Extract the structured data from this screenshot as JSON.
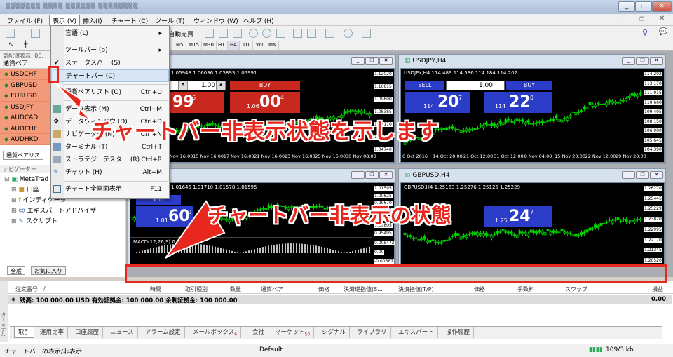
{
  "menubar": {
    "items": [
      "ファイル (F)",
      "表示 (V)",
      "挿入(I)",
      "チャート (C)",
      "ツール (T)",
      "ウィンドウ (W)",
      "ヘルプ (H)"
    ]
  },
  "toolbar": {
    "autotrade": "自動売買",
    "timeframes": [
      "M5",
      "M15",
      "M30",
      "H1",
      "H4",
      "D1",
      "W1",
      "MN"
    ]
  },
  "dropdown": {
    "items": [
      {
        "label": "言語 (L)",
        "sc": "▸"
      },
      {
        "label": "ツールバー (b)",
        "sc": "▸"
      },
      {
        "label": "ステータスバー (S)",
        "sc": ""
      },
      {
        "label": "チャートバー (C)",
        "sc": ""
      },
      {
        "label": "通貨ペアリスト (O)",
        "sc": "Ctrl+U"
      },
      {
        "label": "データ表示 (M)",
        "sc": "Ctrl+M"
      },
      {
        "label": "データウィンドウ (D)",
        "sc": "Ctrl+D"
      },
      {
        "label": "ナビゲーター (N)",
        "sc": "Ctrl+N"
      },
      {
        "label": "ターミナル (T)",
        "sc": "Ctrl+T"
      },
      {
        "label": "ストラテジーテスター (R)",
        "sc": "Ctrl+R"
      },
      {
        "label": "チャット (H)",
        "sc": "Alt+M"
      },
      {
        "label": "チャート全画面表示",
        "sc": "F11"
      }
    ]
  },
  "marketwatch": {
    "title": "気配値表示: 06:",
    "header": "通貨ペア",
    "symbols": [
      "USDCHF",
      "GBPUSD",
      "EURUSD",
      "USDJPY",
      "AUDCAD",
      "AUDCHF",
      "AUDHKD"
    ],
    "tab": "通貨ペアリス"
  },
  "navigator": {
    "title": "ナビゲーター",
    "items": [
      "MetaTrad",
      "口座",
      "インディケータ",
      "エキスパートアドバイザ",
      "スクリプト"
    ],
    "tabs": [
      "全般",
      "お気に入り"
    ]
  },
  "charts": {
    "c1": {
      "info": "1.05948 1.06036 1.05893 1.05991",
      "price": "1.00",
      "buy": "BUY",
      "sell_small": "0.",
      "sell_big": "99",
      "sell_sup": "6",
      "buy_small": "1.06",
      "buy_big": "00",
      "buy_sup": "4",
      "ylabels": [
        "1.12020",
        "1.10815",
        "1.09600",
        "1.08385",
        "1.07170",
        "1.05991",
        "1.04740"
      ],
      "xlabels": [
        "Nov 08:00",
        "11 Nov 16:00",
        "15 Nov 16:00",
        "17 Nov 16:00",
        "21 Nov 16:00",
        "23 Nov 16:00",
        "25 Nov 16:00",
        "30 Nov 08:00"
      ]
    },
    "c2": {
      "title": "USDJPY,H4",
      "info": "USDJPY,H4  114.489 114.536 114.184 114.202",
      "sell": "SELL",
      "buy": "BUY",
      "price": "1.00",
      "sell_small": "114",
      "sell_big": "20",
      "sell_sup": "7",
      "buy_small": "114",
      "buy_big": "22",
      "buy_sup": "0",
      "ylabels": [
        "114.202",
        "113.170",
        "111.915",
        "110.660",
        "109.405",
        "108.150",
        "106.900",
        "105.645",
        "104.390"
      ],
      "xlabels": [
        "6 Oct 2016",
        "14 Oct 20:00",
        "21 Oct 12:00",
        "31 Oct 12:00",
        "8 Nov 04:00",
        "15 Nov 20:00",
        "22 Nov 12:00",
        "29 Nov 20:00"
      ]
    },
    "c3": {
      "title": "4",
      "info": "1.01645 1.01710 1.01578 1.01595",
      "sell": "SELL",
      "sell_small": "1.01",
      "sell_big": "60",
      "sell_sup": "0",
      "ylabels": [
        "1.01595",
        "1.00625",
        "0.99670",
        "0.98715",
        "0.97760",
        "0.96805",
        "0.95495"
      ],
      "macd": "MACD(12,26,9) 0.00101",
      "macd_labels": [
        "0.005472",
        "0.00",
        "-0.00567"
      ]
    },
    "c4": {
      "title": "GBPUSD,H4",
      "info": "GBPUSD,H4  1.25163 1.25276 1.25125 1.25229",
      "sell_small": "1.25",
      "sell_big": "24",
      "sell_sup": "7",
      "ylabels": [
        "1.26270",
        "1.25445",
        "1.25229",
        "1.23820",
        "1.22995",
        "1.22170",
        "1.21345",
        "1.20520"
      ]
    }
  },
  "annotations": {
    "top": "チャートバー非表示状態を示します",
    "bottom": "チャートバー非表示の状態"
  },
  "terminal": {
    "headers": [
      "注文番号",
      "/",
      "時間",
      "取引種別",
      "数量",
      "通貨ペア",
      "価格",
      "決済逆指値(S...",
      "決済指値(T/P)",
      "価格",
      "手数料",
      "スワップ",
      "損益"
    ],
    "balance": "残高: 100 000.00 USD  有効証拠金: 100 000.00  余剰証拠金: 100 000.00",
    "total": "0.00",
    "side": "ターミナル",
    "tabs": [
      "取引",
      "運用比率",
      "口座履歴",
      "ニュース",
      "アラーム設定",
      "メールボックス",
      "会社",
      "マーケット",
      "シグナル",
      "ライブラリ",
      "エキスパート",
      "操作履歴"
    ],
    "mail_count": "6",
    "market_count": "50"
  },
  "status": {
    "left": "チャートバーの表示/非表示",
    "profile": "Default",
    "conn": "109/3 kb"
  }
}
